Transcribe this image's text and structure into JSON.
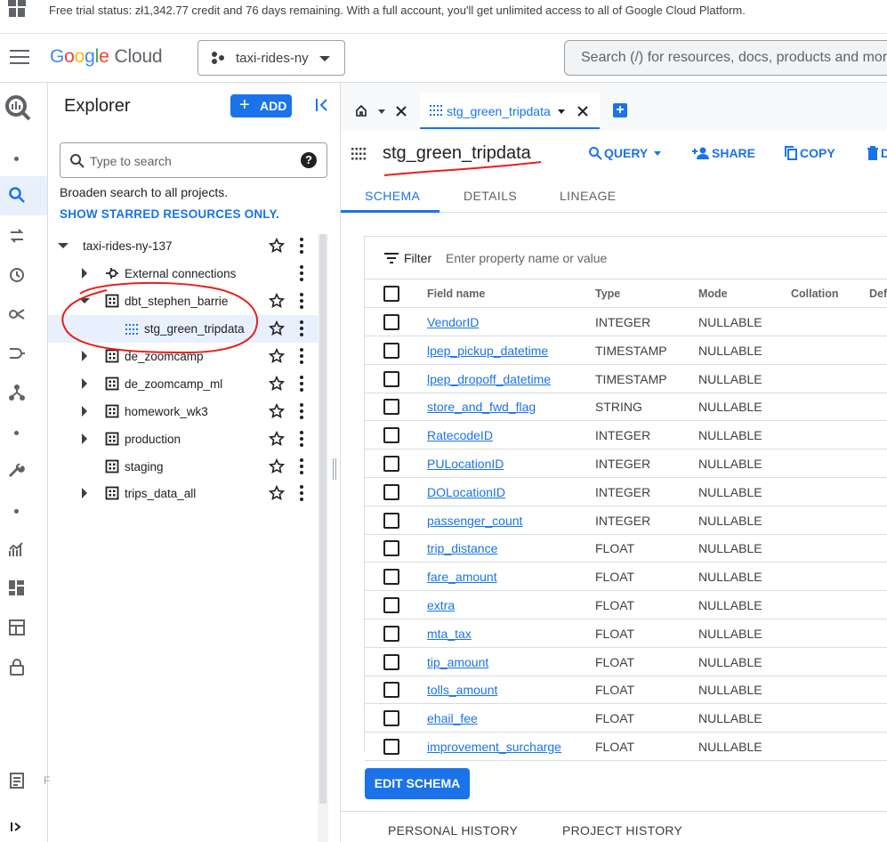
{
  "trial_banner": {
    "text": "Free trial status: zł1,342.77 credit and 76 days remaining. With a full account, you'll get unlimited access to all of Google Cloud Platform."
  },
  "header": {
    "logo_google": "Google",
    "logo_cloud": "Cloud",
    "project": "taxi-rides-ny",
    "search_placeholder": "Search (/) for resources, docs, products and more"
  },
  "rail": {
    "bottom_label": "F"
  },
  "explorer": {
    "title": "Explorer",
    "add_label": "ADD",
    "search_placeholder": "Type to search",
    "help": "?",
    "broaden": "Broaden search to all projects.",
    "starred_link": "SHOW STARRED RESOURCES ONLY.",
    "tree": [
      {
        "label": "taxi-rides-ny-137"
      },
      {
        "label": "External connections"
      },
      {
        "label": "dbt_stephen_barrie"
      },
      {
        "label": "stg_green_tripdata"
      },
      {
        "label": "de_zoomcamp"
      },
      {
        "label": "de_zoomcamp_ml"
      },
      {
        "label": "homework_wk3"
      },
      {
        "label": "production"
      },
      {
        "label": "staging"
      },
      {
        "label": "trips_data_all"
      }
    ]
  },
  "tabs": {
    "active_label": "stg_green_tripdata"
  },
  "table": {
    "name": "stg_green_tripdata",
    "actions": {
      "query": "QUERY",
      "share": "SHARE",
      "copy": "COPY",
      "delete": "D"
    },
    "subtabs": [
      "SCHEMA",
      "DETAILS",
      "LINEAGE"
    ],
    "filter_label": "Filter",
    "filter_placeholder": "Enter property name or value",
    "columns": [
      "Field name",
      "Type",
      "Mode",
      "Collation",
      "Def"
    ],
    "rows": [
      {
        "name": "VendorID",
        "type": "INTEGER",
        "mode": "NULLABLE"
      },
      {
        "name": "lpep_pickup_datetime",
        "type": "TIMESTAMP",
        "mode": "NULLABLE"
      },
      {
        "name": "lpep_dropoff_datetime",
        "type": "TIMESTAMP",
        "mode": "NULLABLE"
      },
      {
        "name": "store_and_fwd_flag",
        "type": "STRING",
        "mode": "NULLABLE"
      },
      {
        "name": "RatecodeID",
        "type": "INTEGER",
        "mode": "NULLABLE"
      },
      {
        "name": "PULocationID",
        "type": "INTEGER",
        "mode": "NULLABLE"
      },
      {
        "name": "DOLocationID",
        "type": "INTEGER",
        "mode": "NULLABLE"
      },
      {
        "name": "passenger_count",
        "type": "INTEGER",
        "mode": "NULLABLE"
      },
      {
        "name": "trip_distance",
        "type": "FLOAT",
        "mode": "NULLABLE"
      },
      {
        "name": "fare_amount",
        "type": "FLOAT",
        "mode": "NULLABLE"
      },
      {
        "name": "extra",
        "type": "FLOAT",
        "mode": "NULLABLE"
      },
      {
        "name": "mta_tax",
        "type": "FLOAT",
        "mode": "NULLABLE"
      },
      {
        "name": "tip_amount",
        "type": "FLOAT",
        "mode": "NULLABLE"
      },
      {
        "name": "tolls_amount",
        "type": "FLOAT",
        "mode": "NULLABLE"
      },
      {
        "name": "ehail_fee",
        "type": "FLOAT",
        "mode": "NULLABLE"
      },
      {
        "name": "improvement_surcharge",
        "type": "FLOAT",
        "mode": "NULLABLE"
      }
    ],
    "edit_schema": "EDIT SCHEMA",
    "history": [
      "PERSONAL HISTORY",
      "PROJECT HISTORY"
    ]
  },
  "colors": {
    "accent": "#1a73e8",
    "annotation": "#e8201b",
    "selected_bg": "#e8f0fe"
  }
}
